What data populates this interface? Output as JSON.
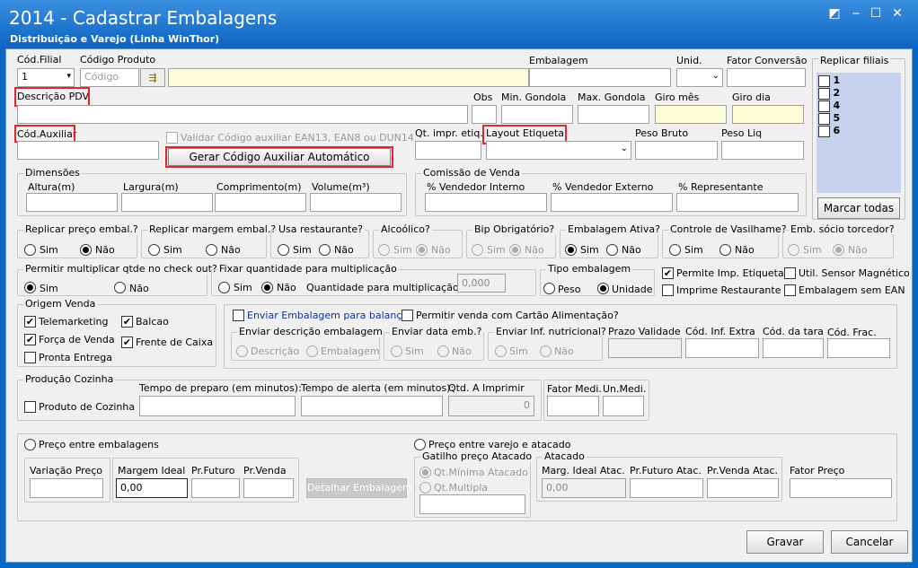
{
  "window": {
    "title": "2014 - Cadastrar Embalagens",
    "subtitle": "Distribuição e Varejo (Linha WinThor)"
  },
  "row1": {
    "cod_filial_label": "Cód.Filial",
    "cod_filial_value": "1",
    "cod_produto_label": "Código Produto",
    "cod_produto_placeholder": "Código",
    "embalagem_label": "Embalagem",
    "unid_label": "Unid.",
    "fator_conversao_label": "Fator Conversão",
    "replicar_filiais_label": "Replicar filiais"
  },
  "filiais": [
    "1",
    "2",
    "4",
    "5",
    "6"
  ],
  "marcar_todas": "Marcar todas",
  "row2": {
    "descricao_pdv": "Descrição PDV",
    "obs": "Obs",
    "min_gondola": "Min. Gondola",
    "max_gondola": "Max. Gondola",
    "giro_mes": "Giro mês",
    "giro_dia": "Giro dia"
  },
  "row3": {
    "cod_auxiliar": "Cód.Auxiliar",
    "validar": "Validar Código auxiliar EAN13, EAN8 ou DUN14",
    "gerar": "Gerar Código Auxiliar Automático",
    "qt_impr": "Qt. impr. etiq.",
    "layout_etiqueta": "Layout Etiqueta",
    "peso_bruto": "Peso Bruto",
    "peso_liq": "Peso Liq"
  },
  "dimensoes": {
    "title": "Dimensões",
    "altura": "Altura(m)",
    "largura": "Largura(m)",
    "comprimento": "Comprimento(m)",
    "volume": "Volume(m³)"
  },
  "comissao": {
    "title": "Comissão de Venda",
    "vend_interno": "% Vendedor Interno",
    "vend_externo": "% Vendedor Externo",
    "representante": "% Representante"
  },
  "sim": "Sim",
  "nao": "Não",
  "opts": {
    "replicar_preco": "Replicar preço embal.?",
    "replicar_margem": "Replicar margem embal.?",
    "usa_restaurante": "Usa restaurante?",
    "alcoolico": "Alcoólico?",
    "bip": "Bip Obrigatório?",
    "embalagem_ativa": "Embalagem Ativa?",
    "controle_vasilhame": "Controle de Vasilhame?",
    "emb_socio": "Emb. sócio torcedor?"
  },
  "row5": {
    "permitir_multiplicar": "Permitir multiplicar qtde no check out?",
    "fixar_qtde": "Fixar quantidade para multiplicação",
    "qtde_mult_label": "Quantidade para multiplicação:",
    "qtde_mult_value": "0,000",
    "tipo_embalagem": "Tipo embalagem",
    "peso": "Peso",
    "unidade": "Unidade",
    "permite_imp_etiqueta": "Permite Imp. Etiqueta",
    "util_sensor": "Util. Sensor Magnético",
    "imprime_restaurante": "Imprime Restaurante",
    "embalagem_sem_ean": "Embalagem sem EAN"
  },
  "origem": {
    "title": "Origem Venda",
    "telemarketing": "Telemarketing",
    "balcao": "Balcao",
    "forca_venda": "Força de Venda",
    "frente_caixa": "Frente de Caixa",
    "pronta_entrega": "Pronta Entrega"
  },
  "balanca": {
    "enviar_balanca": "Enviar Embalagem para balança",
    "permitir_cartao": "Permitir venda com Cartão Alimentação?",
    "enviar_descricao": "Enviar descrição embalagem",
    "descricao": "Descrição",
    "embalagem": "Embalagem",
    "enviar_data": "Enviar data emb.?",
    "enviar_inf": "Enviar Inf. nutricional?",
    "prazo_validade": "Prazo Validade",
    "cod_inf_extra": "Cód. Inf. Extra",
    "cod_tara": "Cód. da tara",
    "cod_frac": "Cód. Frac."
  },
  "cozinha": {
    "title": "Produção Cozinha",
    "produto_cozinha": "Produto de Cozinha",
    "tempo_preparo": "Tempo de preparo (em minutos):",
    "tempo_alerta": "Tempo de alerta (em minutos):",
    "qtd_imprimir": "Qtd. A Imprimir",
    "qtd_value": "0",
    "fator_medi": "Fator Medi.",
    "un_medi": "Un.Medi."
  },
  "preco": {
    "entre_embalagens": "Preço entre embalagens",
    "variacao": "Variação Preço",
    "margem_ideal": "Margem Ideal",
    "margem_value": "0,00",
    "pr_futuro": "Pr.Futuro",
    "pr_venda": "Pr.Venda",
    "detalhar": "Detalhar Embalagem",
    "entre_varejo": "Preço entre varejo e atacado",
    "gatilho": "Gatilho preço Atacado",
    "qt_minima": "Qt.Mínima Atacado",
    "qt_multipla": "Qt.Multipla",
    "atacado": "Atacado",
    "marg_ideal_atac": "Marg. Ideal Atac.",
    "marg_atac_value": "0,00",
    "pr_futuro_atac": "Pr.Futuro Atac.",
    "pr_venda_atac": "Pr.Venda Atac.",
    "fator_preco": "Fator Preço"
  },
  "buttons": {
    "gravar": "Gravar",
    "cancelar": "Cancelar"
  }
}
